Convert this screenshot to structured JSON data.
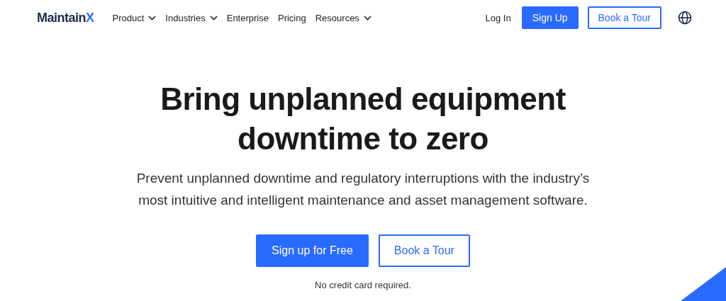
{
  "logo": {
    "name": "Maintain",
    "mark": "X"
  },
  "nav": [
    {
      "label": "Product",
      "dropdown": true
    },
    {
      "label": "Industries",
      "dropdown": true
    },
    {
      "label": "Enterprise",
      "dropdown": false
    },
    {
      "label": "Pricing",
      "dropdown": false
    },
    {
      "label": "Resources",
      "dropdown": true
    }
  ],
  "actions": [
    {
      "label": "Log In",
      "kind": "link"
    },
    {
      "label": "Sign Up",
      "kind": "primary"
    },
    {
      "label": "Book a Tour",
      "kind": "outline"
    }
  ],
  "hero": {
    "title_lines": [
      "Bring unplanned equipment",
      "downtime to zero"
    ],
    "subtitle_lines": [
      "Prevent unplanned downtime and regulatory interruptions with the industry’s",
      "most intuitive and intelligent maintenance and asset management software."
    ],
    "buttons": [
      {
        "label": "Sign up for Free",
        "kind": "primary"
      },
      {
        "label": "Book a Tour",
        "kind": "outline"
      }
    ],
    "note": "No credit card required."
  }
}
